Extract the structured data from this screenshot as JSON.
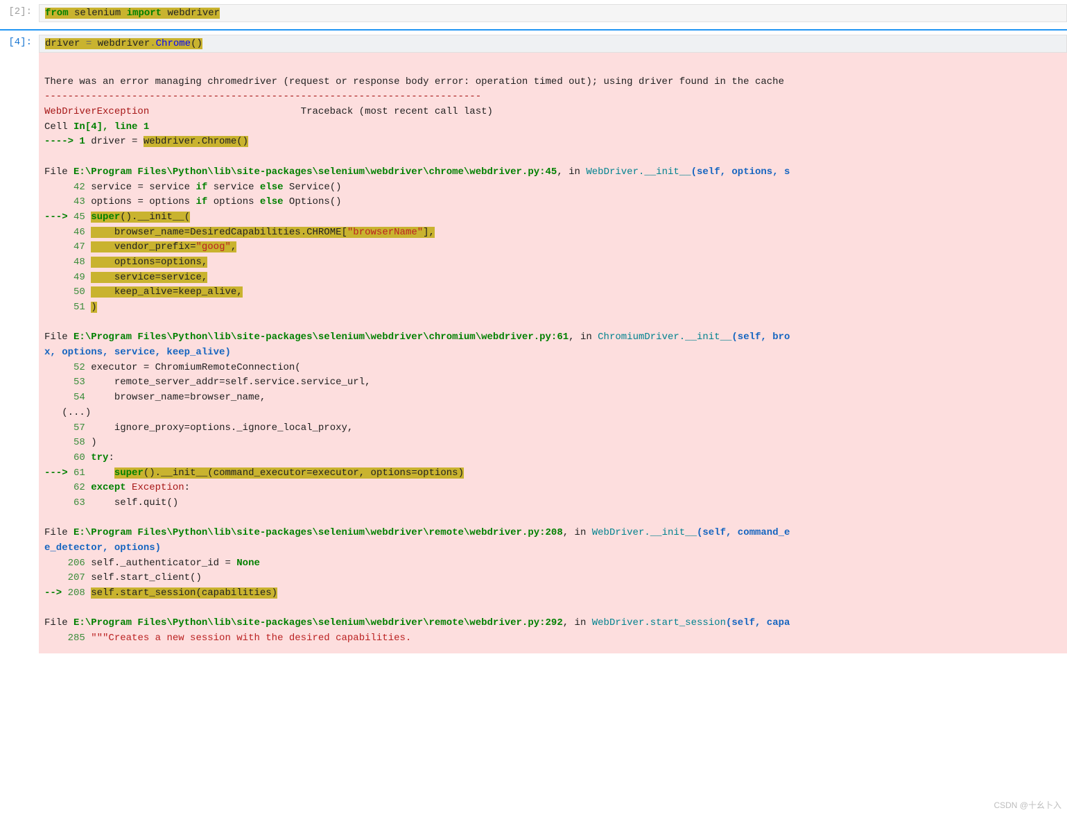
{
  "cells": [
    {
      "prompt": "[2]:",
      "code": {
        "tokens": [
          {
            "t": "from ",
            "c": "kw"
          },
          {
            "t": "selenium ",
            "c": "nm"
          },
          {
            "t": "import ",
            "c": "kw"
          },
          {
            "t": "webdriver",
            "c": "nm"
          }
        ],
        "highlighted": true
      }
    },
    {
      "prompt": "[4]:",
      "code": {
        "tokens": [
          {
            "t": "driver ",
            "c": "nm"
          },
          {
            "t": "= ",
            "c": "op"
          },
          {
            "t": "webdriver",
            "c": "nm"
          },
          {
            "t": ".",
            "c": "op"
          },
          {
            "t": "Chrome",
            "c": "fn"
          },
          {
            "t": "()",
            "c": "op"
          }
        ],
        "highlighted": true
      },
      "error": {
        "pre": "There was an error managing chromedriver (request or response body error: operation timed out); using driver found in the cache",
        "dashes": "---------------------------------------------------------------------------",
        "exc_name": "WebDriverException",
        "exc_tb": "                          Traceback (most recent call last)",
        "cell_loc_a": "Cell ",
        "cell_loc_b": "In[4], line 1",
        "arrow1": "----> 1",
        "l1_a": " driver ",
        "l1_b": "=",
        "l1_c": " ",
        "l1_hl": "webdriver.Chrome()",
        "f1_pre": "File ",
        "f1_path": "E:\\Program Files\\Python\\lib\\site-packages\\selenium\\webdriver\\chrome\\webdriver.py:45",
        "f1_in": ", in ",
        "f1_call": "WebDriver.__init__",
        "f1_args": "(self, options, s",
        "f1_l42": "     42 service = service if service else Service()",
        "f1_l42_ln": "42",
        "f1_l42_txt_a": " service ",
        "f1_l42_eq": "=",
        "f1_l42_txt_b": " service ",
        "f1_l42_if": "if",
        "f1_l42_txt_c": " service ",
        "f1_l42_else": "else",
        "f1_l42_txt_d": " Service()",
        "f1_l43_ln": "43",
        "f1_l43_txt_a": " options ",
        "f1_l43_eq": "=",
        "f1_l43_txt_b": " options ",
        "f1_l43_if": "if",
        "f1_l43_txt_c": " options ",
        "f1_l43_else": "else",
        "f1_l43_txt_d": " Options()",
        "f1_arrow": "---> ",
        "f1_l45_ln": "45",
        "f1_l45_hl_a": "super",
        "f1_l45_hl_b": "().",
        "f1_l45_hl_c": "__init__",
        "f1_l45_hl_d": "(",
        "f1_l46_ln": "46",
        "f1_l46_hl_a": "    browser_name",
        "f1_l46_hl_b": "=",
        "f1_l46_hl_c": "DesiredCapabilities.CHROME[",
        "f1_l46_hl_d": "\"browserName\"",
        "f1_l46_hl_e": "],",
        "f1_l47_ln": "47",
        "f1_l47_hl_a": "    vendor_prefix",
        "f1_l47_hl_b": "=",
        "f1_l47_hl_c": "\"goog\"",
        "f1_l47_hl_d": ",",
        "f1_l48_ln": "48",
        "f1_l48_hl": "    options=options,",
        "f1_l49_ln": "49",
        "f1_l49_hl": "    service=service,",
        "f1_l50_ln": "50",
        "f1_l50_hl": "    keep_alive=keep_alive,",
        "f1_l51_ln": "51",
        "f1_l51_hl": ")",
        "f2_pre": "File ",
        "f2_path": "E:\\Program Files\\Python\\lib\\site-packages\\selenium\\webdriver\\chromium\\webdriver.py:61",
        "f2_in": ", in ",
        "f2_call": "ChromiumDriver.__init__",
        "f2_args": "(self, bro",
        "f2_args2": "x, options, service, keep_alive)",
        "f2_l52_ln": "52",
        "f2_l52_txt": " executor = ChromiumRemoteConnection(",
        "f2_l53_ln": "53",
        "f2_l53_txt_a": "     remote_server_addr",
        "f2_l53_eq": "=",
        "f2_l53_txt_b": "self.service.service_url,",
        "f2_l54_ln": "54",
        "f2_l54_txt_a": "     browser_name",
        "f2_l54_eq": "=",
        "f2_l54_txt_b": "browser_name,",
        "f2_dots": "   (...)",
        "f2_l57_ln": "57",
        "f2_l57_txt_a": "     ignore_proxy",
        "f2_l57_eq": "=",
        "f2_l57_txt_b": "options._ignore_local_proxy,",
        "f2_l58_ln": "58",
        "f2_l58_txt": " )",
        "f2_l60_ln": "60",
        "f2_l60_try": " try",
        "f2_l60_colon": ":",
        "f2_arrow": "---> ",
        "f2_l61_ln": "61",
        "f2_l61_hl_a": "super",
        "f2_l61_hl_b": "().",
        "f2_l61_hl_c": "__init__",
        "f2_l61_hl_d": "(command_executor",
        "f2_l61_hl_e": "=",
        "f2_l61_hl_f": "executor, options",
        "f2_l61_hl_g": "=",
        "f2_l61_hl_h": "options)",
        "f2_l62_ln": "62",
        "f2_l62_except": " except",
        "f2_l62_exc": " Exception",
        "f2_l62_colon": ":",
        "f2_l63_ln": "63",
        "f2_l63_txt": "     self.quit()",
        "f3_pre": "File ",
        "f3_path": "E:\\Program Files\\Python\\lib\\site-packages\\selenium\\webdriver\\remote\\webdriver.py:208",
        "f3_in": ", in ",
        "f3_call": "WebDriver.__init__",
        "f3_args": "(self, command_e",
        "f3_args2": "e_detector, options)",
        "f3_l206_ln": "206",
        "f3_l206_txt_a": " self._authenticator_id ",
        "f3_l206_eq": "= ",
        "f3_l206_none": "None",
        "f3_l207_ln": "207",
        "f3_l207_txt": " self.start_client()",
        "f3_arrow": "--> ",
        "f3_l208_ln": "208",
        "f3_l208_hl": "self.start_session(capabilities)",
        "f4_pre": "File ",
        "f4_path": "E:\\Program Files\\Python\\lib\\site-packages\\selenium\\webdriver\\remote\\webdriver.py:292",
        "f4_in": ", in ",
        "f4_call": "WebDriver.start_session",
        "f4_args": "(self, capa",
        "f4_l285_ln": "285",
        "f4_l285_txt": " \"\"\"Creates a new session with the desired capabilities."
      }
    }
  ],
  "watermark": "CSDN @十幺卜入"
}
